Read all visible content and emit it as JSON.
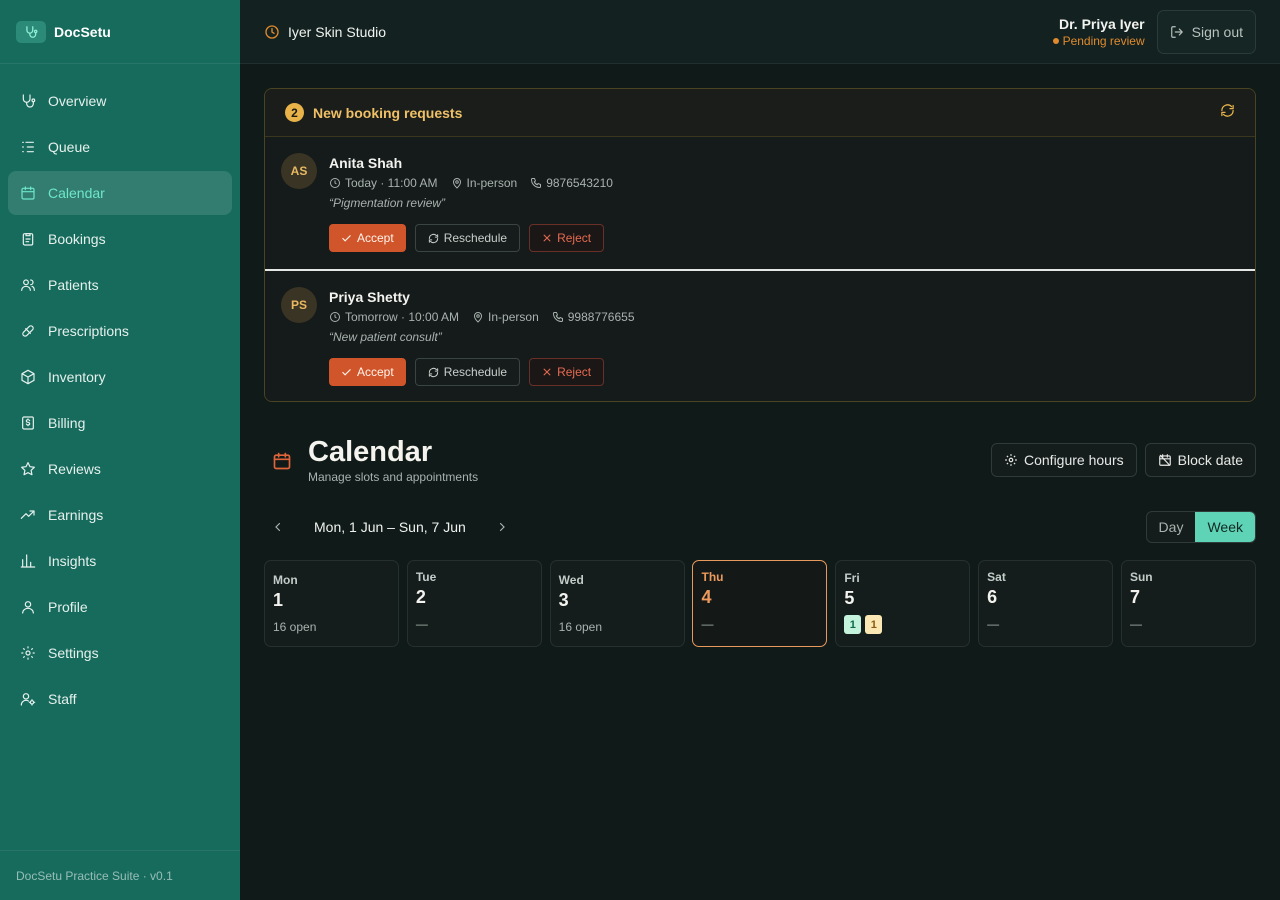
{
  "sidebar": {
    "brand": "DocSetu",
    "items": [
      {
        "label": "Overview",
        "icon": "stethoscope-icon"
      },
      {
        "label": "Queue",
        "icon": "list-icon"
      },
      {
        "label": "Calendar",
        "icon": "calendar-icon",
        "active": true
      },
      {
        "label": "Bookings",
        "icon": "clipboard-icon"
      },
      {
        "label": "Patients",
        "icon": "users-icon"
      },
      {
        "label": "Prescriptions",
        "icon": "pill-icon"
      },
      {
        "label": "Inventory",
        "icon": "package-icon"
      },
      {
        "label": "Billing",
        "icon": "receipt-icon"
      },
      {
        "label": "Reviews",
        "icon": "star-icon"
      },
      {
        "label": "Earnings",
        "icon": "trending-up-icon"
      },
      {
        "label": "Insights",
        "icon": "bar-chart-icon"
      },
      {
        "label": "Profile",
        "icon": "user-icon"
      },
      {
        "label": "Settings",
        "icon": "gear-icon"
      },
      {
        "label": "Staff",
        "icon": "user-cog-icon"
      }
    ],
    "footer": "DocSetu Practice Suite · v0.1"
  },
  "topbar": {
    "clinic": "Iyer Skin Studio",
    "user_name": "Dr. Priya Iyer",
    "user_status": "Pending review",
    "signout": "Sign out"
  },
  "requests": {
    "count": "2",
    "title": "New booking requests",
    "items": [
      {
        "initials": "AS",
        "name": "Anita Shah",
        "time": "Today · 11:00 AM",
        "mode": "In-person",
        "phone": "9876543210",
        "note": "“Pigmentation review”"
      },
      {
        "initials": "PS",
        "name": "Priya Shetty",
        "time": "Tomorrow · 10:00 AM",
        "mode": "In-person",
        "phone": "9988776655",
        "note": "“New patient consult”"
      }
    ],
    "accept": "Accept",
    "reschedule": "Reschedule",
    "reject": "Reject"
  },
  "calendar": {
    "title": "Calendar",
    "subtitle": "Manage slots and appointments",
    "configure": "Configure hours",
    "block": "Block date",
    "range": "Mon, 1 Jun – Sun, 7 Jun",
    "view_day": "Day",
    "view_week": "Week",
    "days": [
      {
        "name": "Mon",
        "num": "1",
        "info": "16 open"
      },
      {
        "name": "Tue",
        "num": "2",
        "info": "—"
      },
      {
        "name": "Wed",
        "num": "3",
        "info": "16 open"
      },
      {
        "name": "Thu",
        "num": "4",
        "info": "—",
        "today": true
      },
      {
        "name": "Fri",
        "num": "5",
        "badges": [
          "1",
          "1"
        ]
      },
      {
        "name": "Sat",
        "num": "6",
        "info": "—"
      },
      {
        "name": "Sun",
        "num": "7",
        "info": "—"
      }
    ]
  },
  "colors": {
    "sidebar": "#166b5c",
    "accent": "#5fd3b6",
    "primary_action": "#d1552a",
    "warning": "#e08a2e"
  }
}
